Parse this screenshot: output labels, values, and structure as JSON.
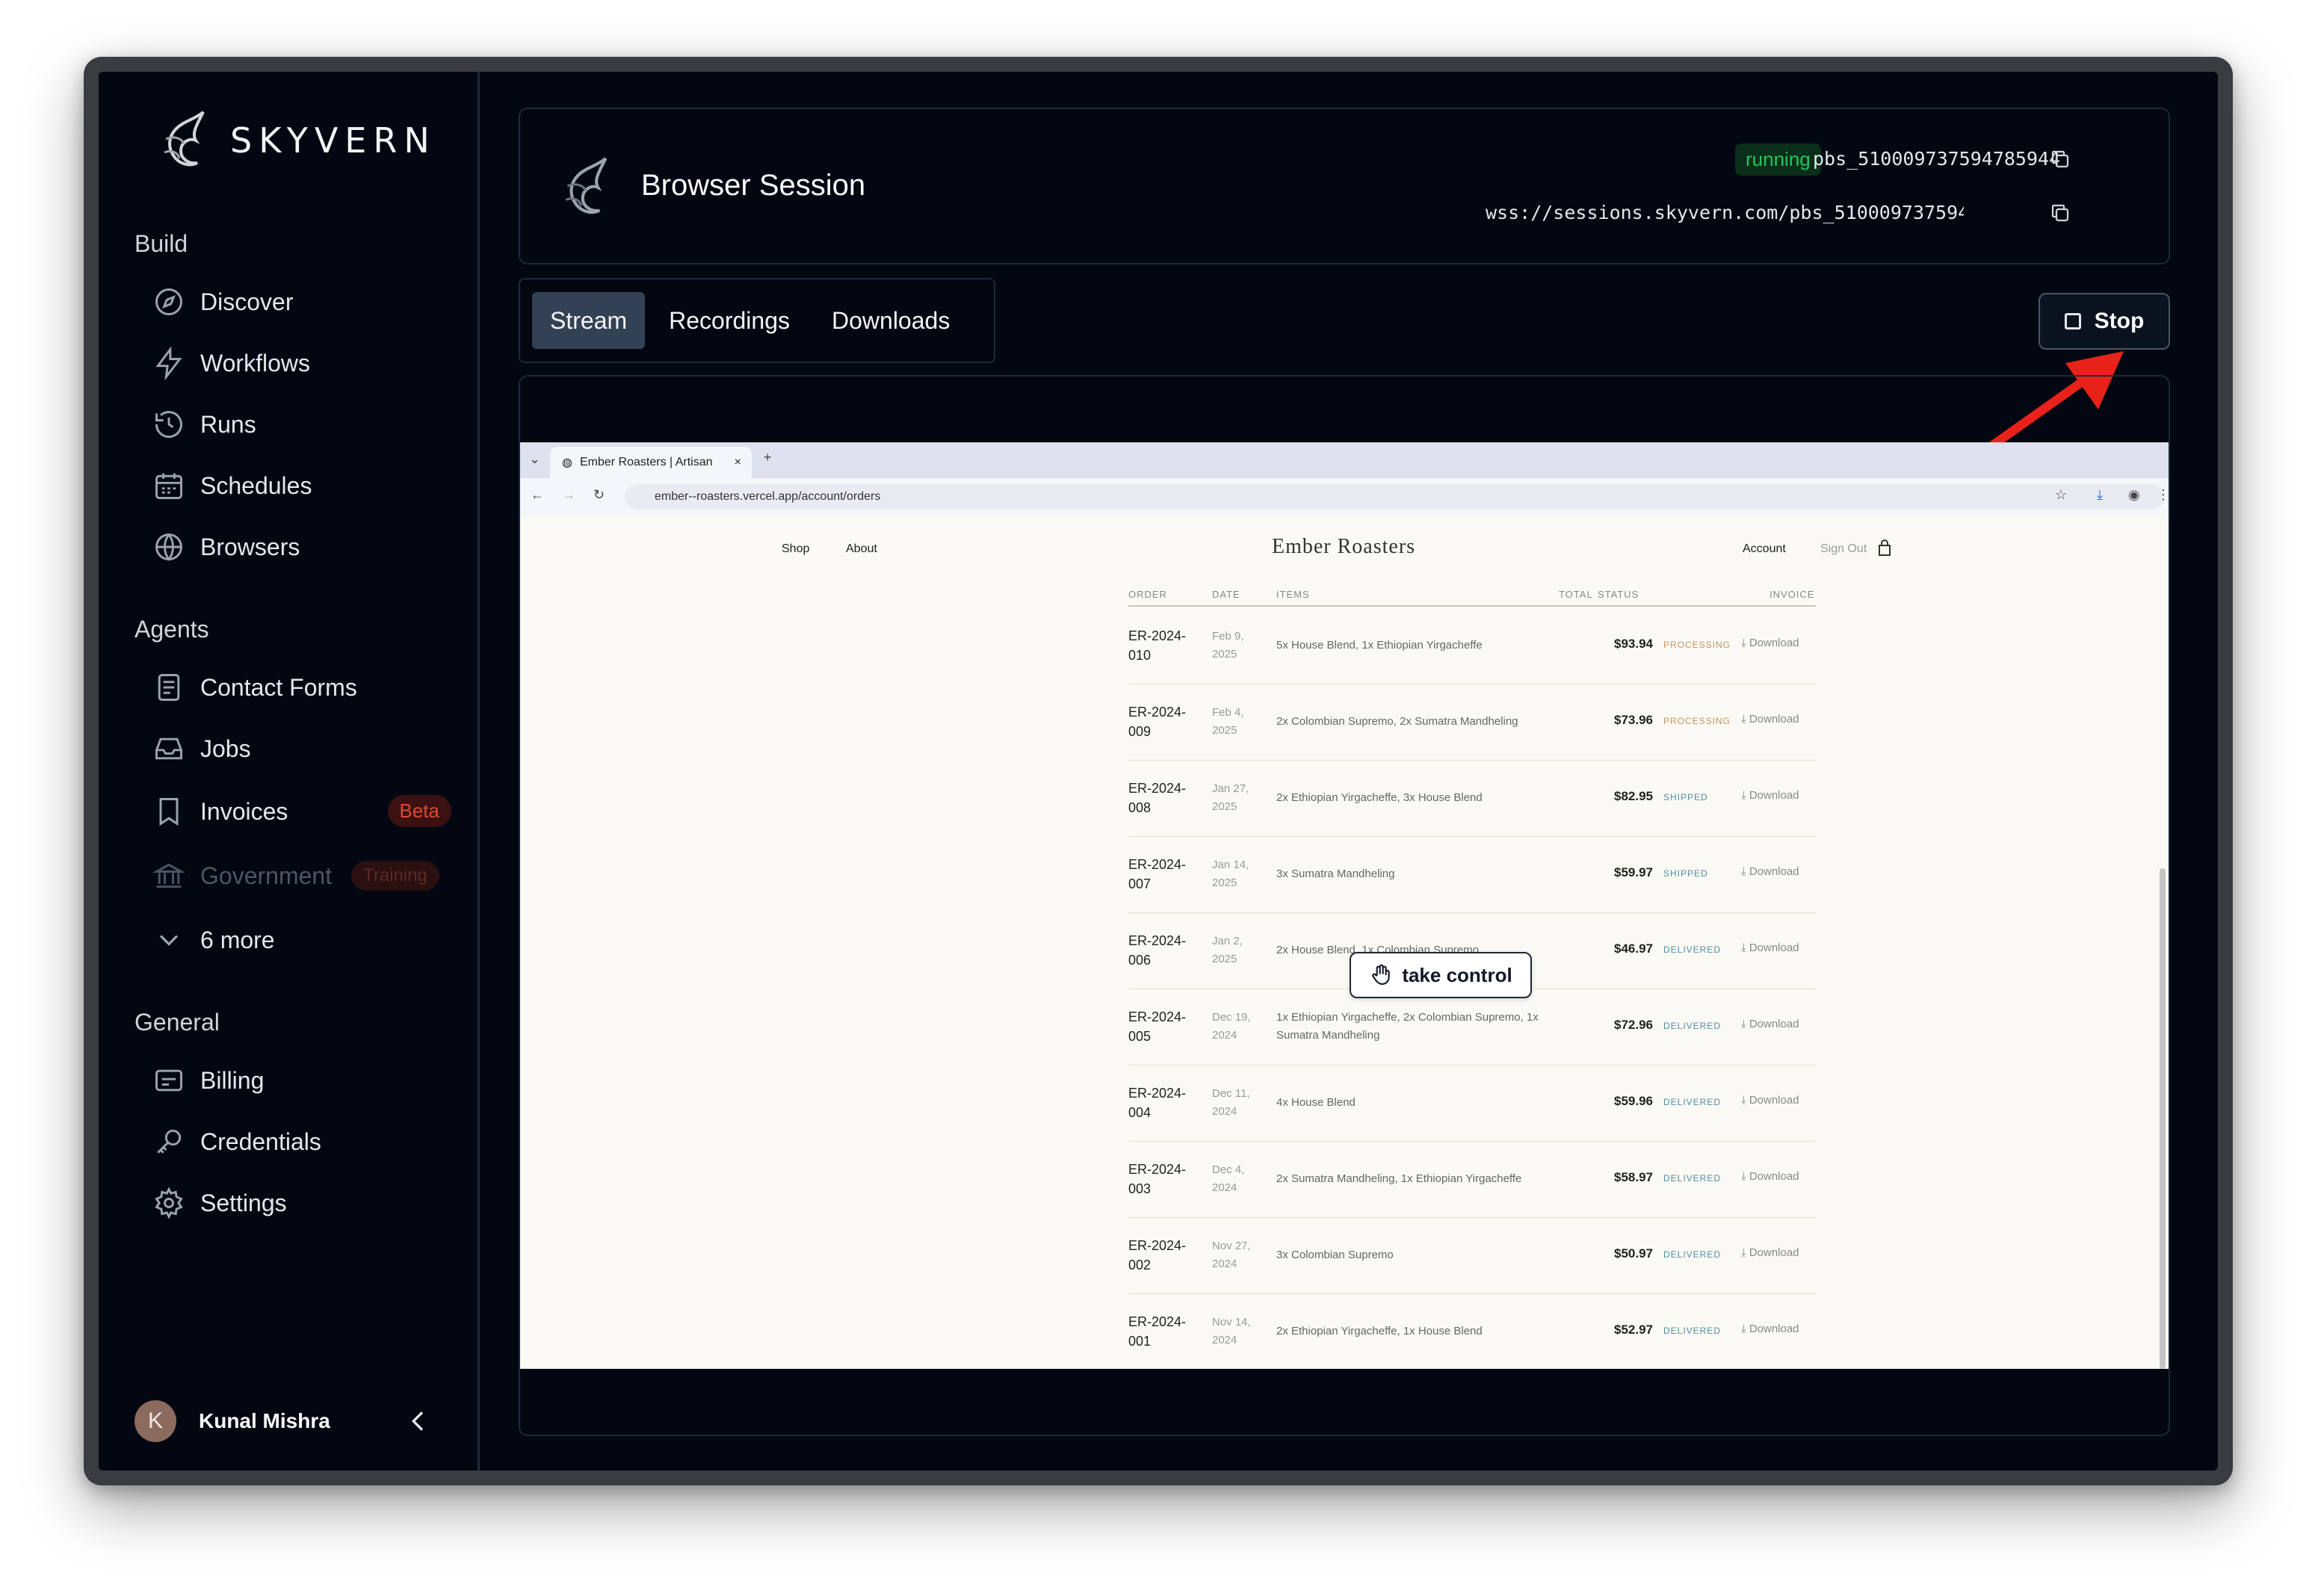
{
  "brand": {
    "name": "SKYVERN"
  },
  "sidebar": {
    "sections": {
      "build": "Build",
      "agents": "Agents",
      "general": "General"
    },
    "build_items": [
      "Discover",
      "Workflows",
      "Runs",
      "Schedules",
      "Browsers"
    ],
    "agent_items": [
      "Contact Forms",
      "Jobs",
      "Invoices",
      "Government"
    ],
    "invoices_badge": "Beta",
    "government_badge": "Training",
    "more_label": "6 more",
    "general_items": [
      "Billing",
      "Credentials",
      "Settings"
    ],
    "user": {
      "initial": "K",
      "name": "Kunal Mishra"
    }
  },
  "session": {
    "title": "Browser Session",
    "status": "running",
    "id": "pbs_510009737594785944",
    "wss": "wss://sessions.skyvern.com/pbs_510009737594…"
  },
  "tabs": [
    "Stream",
    "Recordings",
    "Downloads"
  ],
  "active_tab": "Stream",
  "stop_label": "Stop",
  "browser": {
    "tab_title": "Ember Roasters | Artisan",
    "url": "ember--roasters.vercel.app/account/orders"
  },
  "site": {
    "nav_left": [
      "Shop",
      "About"
    ],
    "title": "Ember Roasters",
    "nav_right": [
      "Account",
      "Sign Out"
    ],
    "columns": [
      "ORDER",
      "DATE",
      "ITEMS",
      "TOTAL",
      "STATUS",
      "INVOICE"
    ],
    "orders": [
      {
        "id1": "ER-2024-",
        "id2": "010",
        "d1": "Feb 9,",
        "d2": "2025",
        "items": "5x House Blend, 1x Ethiopian Yirgacheffe",
        "total": "$93.94",
        "status": "PROCESSING",
        "invoice": "Download"
      },
      {
        "id1": "ER-2024-",
        "id2": "009",
        "d1": "Feb 4,",
        "d2": "2025",
        "items": "2x Colombian Supremo, 2x Sumatra Mandheling",
        "total": "$73.96",
        "status": "PROCESSING",
        "invoice": "Download"
      },
      {
        "id1": "ER-2024-",
        "id2": "008",
        "d1": "Jan 27,",
        "d2": "2025",
        "items": "2x Ethiopian Yirgacheffe, 3x House Blend",
        "total": "$82.95",
        "status": "SHIPPED",
        "invoice": "Download"
      },
      {
        "id1": "ER-2024-",
        "id2": "007",
        "d1": "Jan 14,",
        "d2": "2025",
        "items": "3x Sumatra Mandheling",
        "total": "$59.97",
        "status": "SHIPPED",
        "invoice": "Download"
      },
      {
        "id1": "ER-2024-",
        "id2": "006",
        "d1": "Jan 2,",
        "d2": "2025",
        "items": "2x House Blend, 1x Colombian Supremo",
        "total": "$46.97",
        "status": "DELIVERED",
        "invoice": "Download"
      },
      {
        "id1": "ER-2024-",
        "id2": "005",
        "d1": "Dec 19,",
        "d2": "2024",
        "items": "1x Ethiopian Yirgacheffe, 2x Colombian Supremo, 1x Sumatra Mandheling",
        "total": "$72.96",
        "status": "DELIVERED",
        "invoice": "Download"
      },
      {
        "id1": "ER-2024-",
        "id2": "004",
        "d1": "Dec 11,",
        "d2": "2024",
        "items": "4x House Blend",
        "total": "$59.96",
        "status": "DELIVERED",
        "invoice": "Download"
      },
      {
        "id1": "ER-2024-",
        "id2": "003",
        "d1": "Dec 4,",
        "d2": "2024",
        "items": "2x Sumatra Mandheling, 1x Ethiopian Yirgacheffe",
        "total": "$58.97",
        "status": "DELIVERED",
        "invoice": "Download"
      },
      {
        "id1": "ER-2024-",
        "id2": "002",
        "d1": "Nov 27,",
        "d2": "2024",
        "items": "3x Colombian Supremo",
        "total": "$50.97",
        "status": "DELIVERED",
        "invoice": "Download"
      },
      {
        "id1": "ER-2024-",
        "id2": "001",
        "d1": "Nov 14,",
        "d2": "2024",
        "items": "2x Ethiopian Yirgacheffe, 1x House Blend",
        "total": "$52.97",
        "status": "DELIVERED",
        "invoice": "Download"
      }
    ]
  },
  "take_control_label": "take control",
  "colors": {
    "running": "#22c55e",
    "annotation_arrow": "#e8221b",
    "accent_tab": "#334155"
  }
}
